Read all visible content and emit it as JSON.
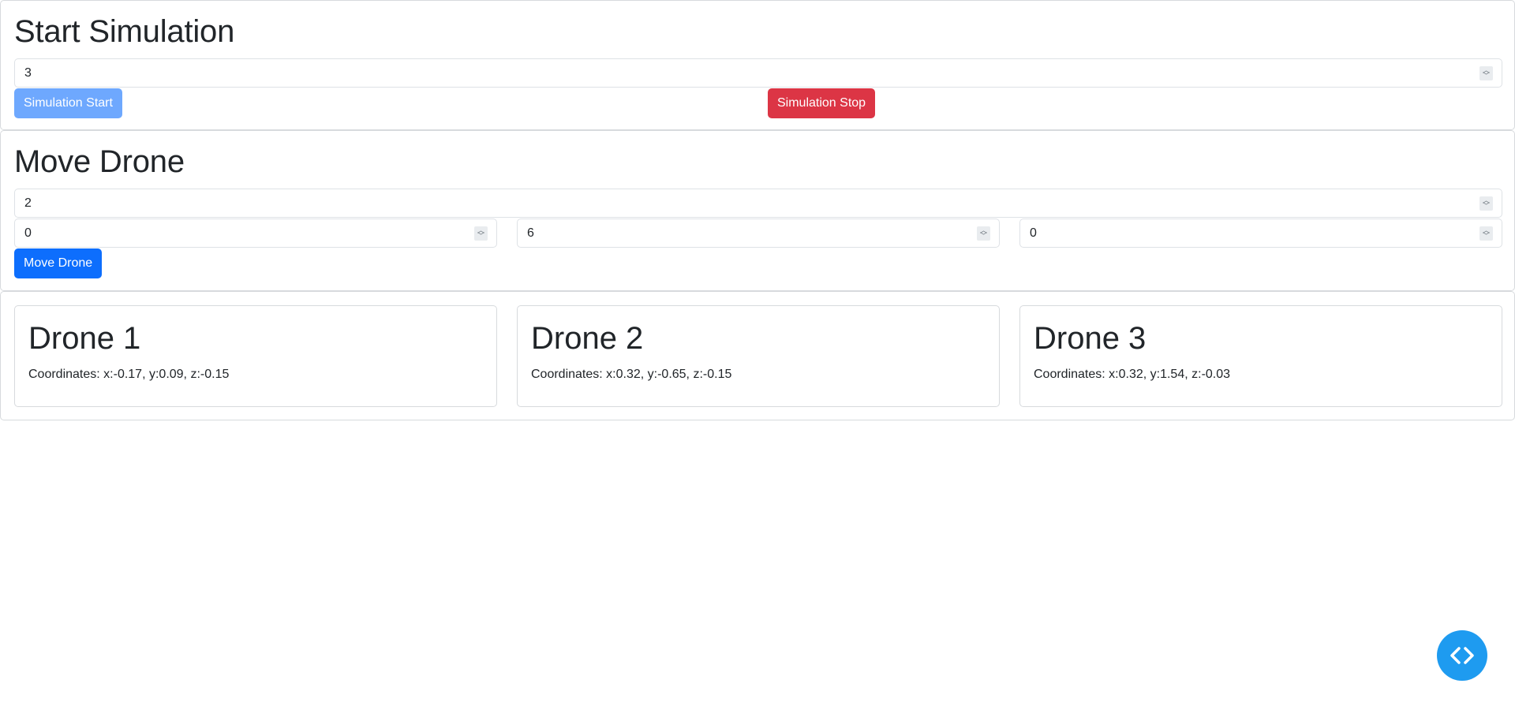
{
  "simulation": {
    "title": "Start Simulation",
    "drone_count_value": "3",
    "start_label": "Simulation Start",
    "stop_label": "Simulation Stop"
  },
  "move": {
    "title": "Move Drone",
    "drone_id_value": "2",
    "x_value": "0",
    "y_value": "6",
    "z_value": "0",
    "button_label": "Move Drone"
  },
  "drones": [
    {
      "name": "Drone 1",
      "coords": "Coordinates: x:-0.17, y:0.09, z:-0.15"
    },
    {
      "name": "Drone 2",
      "coords": "Coordinates: x:0.32, y:-0.65, z:-0.15"
    },
    {
      "name": "Drone 3",
      "coords": "Coordinates: x:0.32, y:1.54, z:-0.03"
    }
  ],
  "fab": {
    "icon": "code-icon",
    "color": "#1e9bf0"
  }
}
